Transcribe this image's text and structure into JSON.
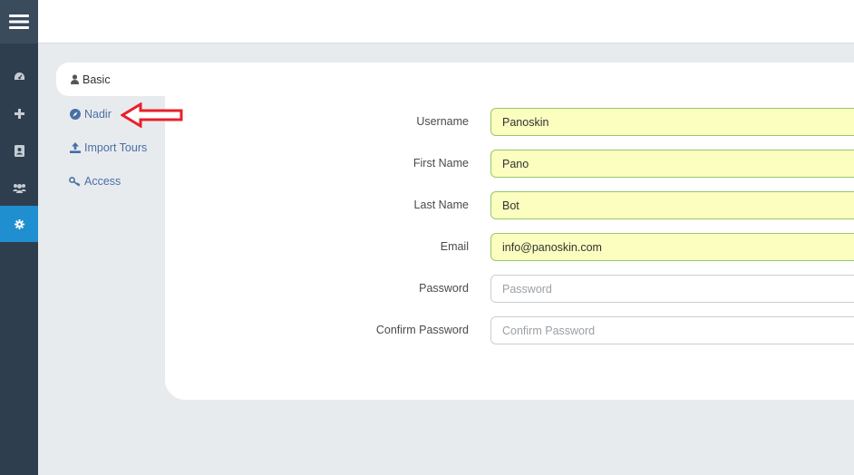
{
  "sidebar": {
    "items": [
      {
        "name": "dashboard",
        "icon": "dashboard-icon"
      },
      {
        "name": "add",
        "icon": "plus-icon"
      },
      {
        "name": "contacts",
        "icon": "address-book-icon"
      },
      {
        "name": "users",
        "icon": "users-icon"
      },
      {
        "name": "settings",
        "icon": "gear-icon",
        "active": true
      }
    ],
    "active_color": "#1f8fcf"
  },
  "tabs": {
    "basic": "Basic",
    "nadir": "Nadir",
    "import_tours": "Import Tours",
    "access": "Access"
  },
  "form": {
    "username": {
      "label": "Username",
      "value": "Panoskin"
    },
    "first_name": {
      "label": "First Name",
      "value": "Pano"
    },
    "last_name": {
      "label": "Last Name",
      "value": "Bot"
    },
    "email": {
      "label": "Email",
      "value": "info@panoskin.com"
    },
    "password": {
      "label": "Password",
      "value": "",
      "placeholder": "Password"
    },
    "confirm_password": {
      "label": "Confirm Password",
      "value": "",
      "placeholder": "Confirm Password"
    }
  },
  "annotation": {
    "arrow_color": "#e8202a"
  }
}
